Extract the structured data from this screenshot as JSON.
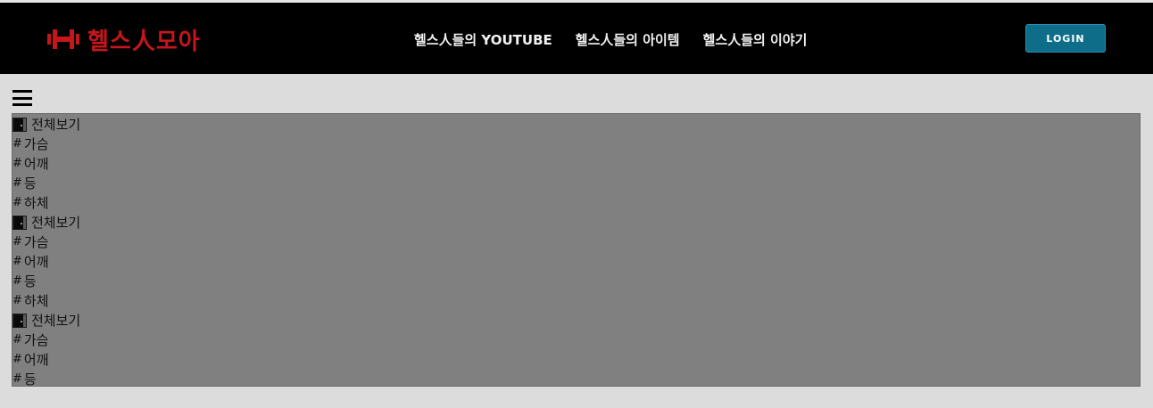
{
  "header": {
    "logo_text": "헬스人모아",
    "logo_icon": "dumbbell-icon",
    "brand_color": "#c4161c",
    "nav": [
      {
        "label": "헬스人들의 YOUTUBE"
      },
      {
        "label": "헬스人들의 아이템"
      },
      {
        "label": "헬스人들의 이야기"
      }
    ],
    "login_label": "LOGIN",
    "login_color": "#0e6e8a"
  },
  "menu": {
    "toggle_icon": "hamburger-icon",
    "hash_symbol": "#",
    "items": [
      {
        "kind": "all",
        "label": "전체보기"
      },
      {
        "kind": "tag",
        "label": "가슴"
      },
      {
        "kind": "tag",
        "label": "어깨"
      },
      {
        "kind": "tag",
        "label": "등"
      },
      {
        "kind": "tag",
        "label": "하체"
      },
      {
        "kind": "all",
        "label": "전체보기"
      },
      {
        "kind": "tag",
        "label": "가슴"
      },
      {
        "kind": "tag",
        "label": "어깨"
      },
      {
        "kind": "tag",
        "label": "등"
      },
      {
        "kind": "tag",
        "label": "하체"
      },
      {
        "kind": "all",
        "label": "전체보기"
      },
      {
        "kind": "tag",
        "label": "가슴"
      },
      {
        "kind": "tag",
        "label": "어깨"
      },
      {
        "kind": "tag",
        "label": "등"
      }
    ]
  }
}
